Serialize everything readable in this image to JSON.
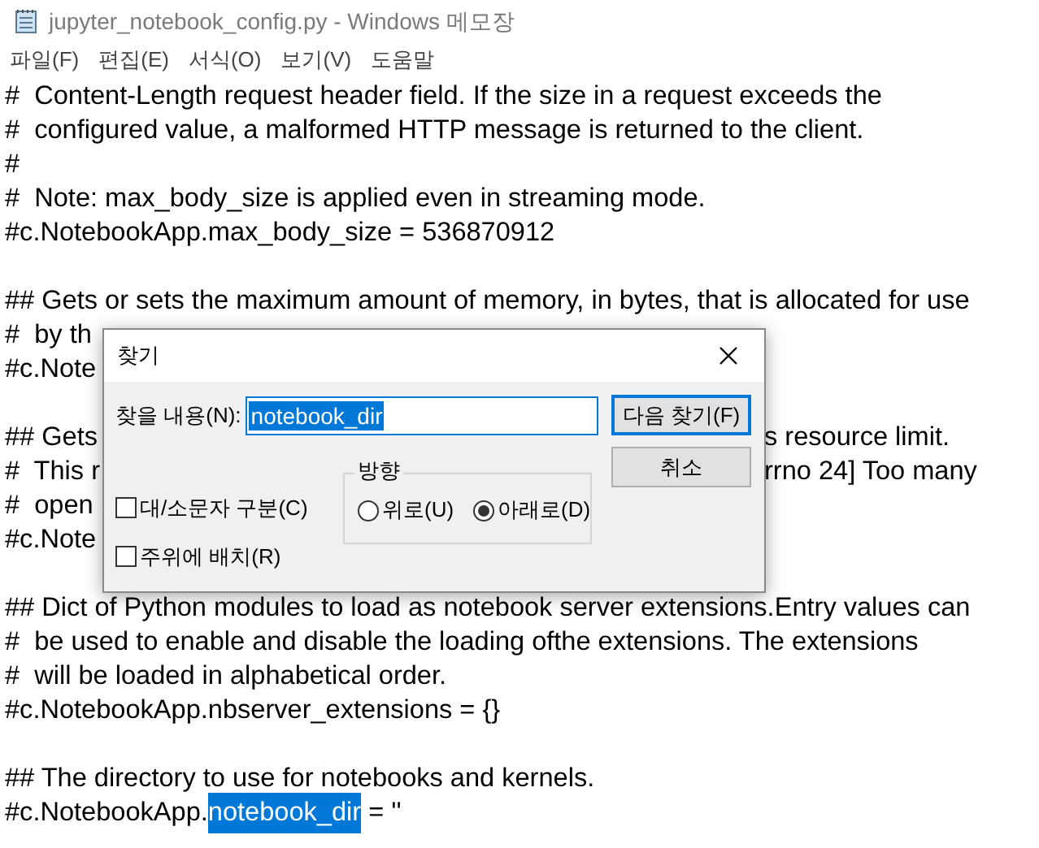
{
  "window": {
    "title": "jupyter_notebook_config.py - Windows 메모장"
  },
  "menu": [
    "파일(F)",
    "편집(E)",
    "서식(O)",
    "보기(V)",
    "도움말"
  ],
  "editor": {
    "lines": [
      {
        "kind": "text",
        "left": "#  Content-Length request header field. If the size in a request exceeds the"
      },
      {
        "kind": "text",
        "left": "#  configured value, a malformed HTTP message is returned to the client."
      },
      {
        "kind": "text",
        "left": "#"
      },
      {
        "kind": "text",
        "left": "#  Note: max_body_size is applied even in streaming mode."
      },
      {
        "kind": "text",
        "left": "#c.NotebookApp.max_body_size = 536870912"
      },
      {
        "kind": "blank"
      },
      {
        "kind": "text",
        "left": "## Gets or sets the maximum amount of memory, in bytes, that is allocated for use"
      },
      {
        "kind": "split",
        "left": "#  by th"
      },
      {
        "kind": "split",
        "left": "#c.Note"
      },
      {
        "kind": "blank"
      },
      {
        "kind": "split",
        "left": "## Gets",
        "right": "s resource limit."
      },
      {
        "kind": "split",
        "left": "#  This r",
        "right": "rrno 24] Too many"
      },
      {
        "kind": "split",
        "left": "#  open"
      },
      {
        "kind": "split",
        "left": "#c.Note"
      },
      {
        "kind": "blank"
      },
      {
        "kind": "text",
        "left": "## Dict of Python modules to load as notebook server extensions.Entry values can"
      },
      {
        "kind": "text",
        "left": "#  be used to enable and disable the loading ofthe extensions. The extensions"
      },
      {
        "kind": "text",
        "left": "#  will be loaded in alphabetical order."
      },
      {
        "kind": "text",
        "left": "#c.NotebookApp.nbserver_extensions = {}"
      },
      {
        "kind": "blank"
      },
      {
        "kind": "text",
        "left": "## The directory to use for notebooks and kernels."
      },
      {
        "kind": "selection",
        "left": "#c.NotebookApp.",
        "selection": "notebook_dir",
        "after": " = ''"
      }
    ]
  },
  "find_dialog": {
    "title": "찾기",
    "find_label": "찾을 내용(N):",
    "find_value": "notebook_dir",
    "buttons": [
      {
        "label": "다음 찾기(F)",
        "default": true
      },
      {
        "label": "취소",
        "default": false
      }
    ],
    "direction": {
      "label": "방향",
      "options": [
        {
          "label": "위로(U)",
          "selected": false
        },
        {
          "label": "아래로(D)",
          "selected": true
        }
      ]
    },
    "checkboxes": [
      {
        "label": "대/소문자 구분(C)",
        "checked": false
      },
      {
        "label": "주위에 배치(R)",
        "checked": false
      }
    ]
  }
}
